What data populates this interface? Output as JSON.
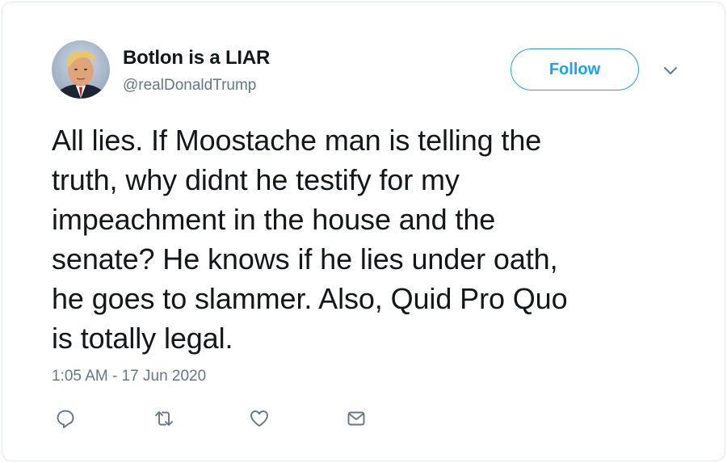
{
  "tweet": {
    "user": {
      "display_name": "Botlon is a LIAR",
      "handle": "@realDonaldTrump",
      "avatar_icon": "profile-photo"
    },
    "follow_label": "Follow",
    "menu_icon": "chevron-down-icon",
    "text_lines": [
      "All lies. If Moostache man is telling the",
      "truth, why didnt he testify for my",
      "impeachment in the house and the",
      "senate? He knows if he lies under oath,",
      "he goes to slammer. Also, Quid Pro Quo",
      "is totally legal."
    ],
    "timestamp": "1:05 AM - 17 Jun 2020",
    "actions": [
      {
        "name": "reply",
        "icon": "reply-icon"
      },
      {
        "name": "retweet",
        "icon": "retweet-icon"
      },
      {
        "name": "like",
        "icon": "heart-icon"
      },
      {
        "name": "direct-message",
        "icon": "envelope-icon"
      }
    ]
  },
  "colors": {
    "accent": "#1da1f2",
    "secondary_text": "#657786",
    "primary_text": "#14171a",
    "border": "#e1e8ed"
  }
}
